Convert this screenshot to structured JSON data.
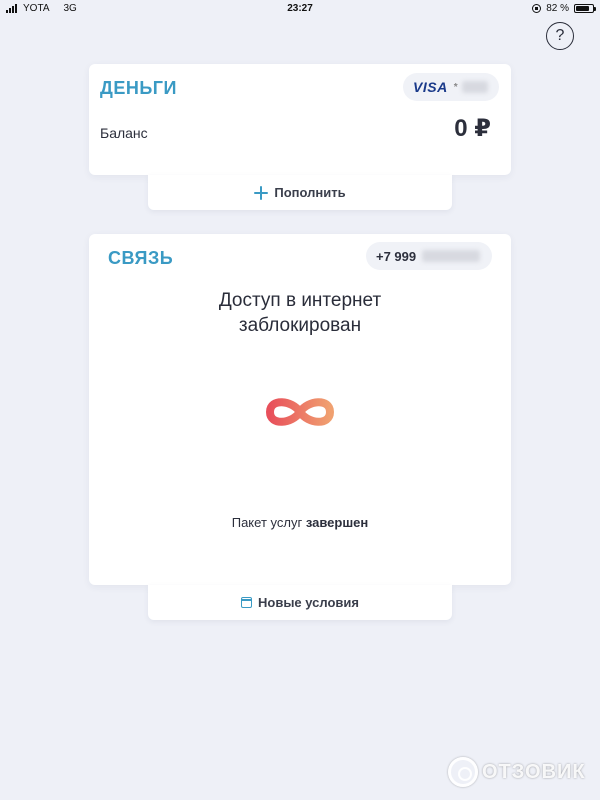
{
  "status_bar": {
    "carrier": "YOTA",
    "network": "3G",
    "time": "23:27",
    "battery_percent": "82 %",
    "battery_level": 0.82
  },
  "help": {
    "label": "?"
  },
  "money": {
    "title": "ДЕНЬГИ",
    "card_brand": "VISA",
    "card_mask": "*",
    "balance_label": "Баланс",
    "balance_value": "0 ₽",
    "topup_label": "Пополнить"
  },
  "connection": {
    "title": "СВЯЗЬ",
    "phone_prefix": "+7 999",
    "blocked_line1": "Доступ в интернет",
    "blocked_line2": "заблокирован",
    "package_prefix": "Пакет услуг",
    "package_status": "завершен",
    "new_terms_label": "Новые условия"
  },
  "watermark": {
    "text": "ОТЗОВИК"
  },
  "colors": {
    "accent": "#3a9ac4",
    "background": "#eef0f7",
    "infinity_start": "#e8505b",
    "infinity_end": "#f0a070"
  },
  "icons": [
    "signal-icon",
    "rotation-lock-icon",
    "battery-icon",
    "help-icon",
    "plus-icon",
    "calendar-icon",
    "infinity-icon"
  ]
}
